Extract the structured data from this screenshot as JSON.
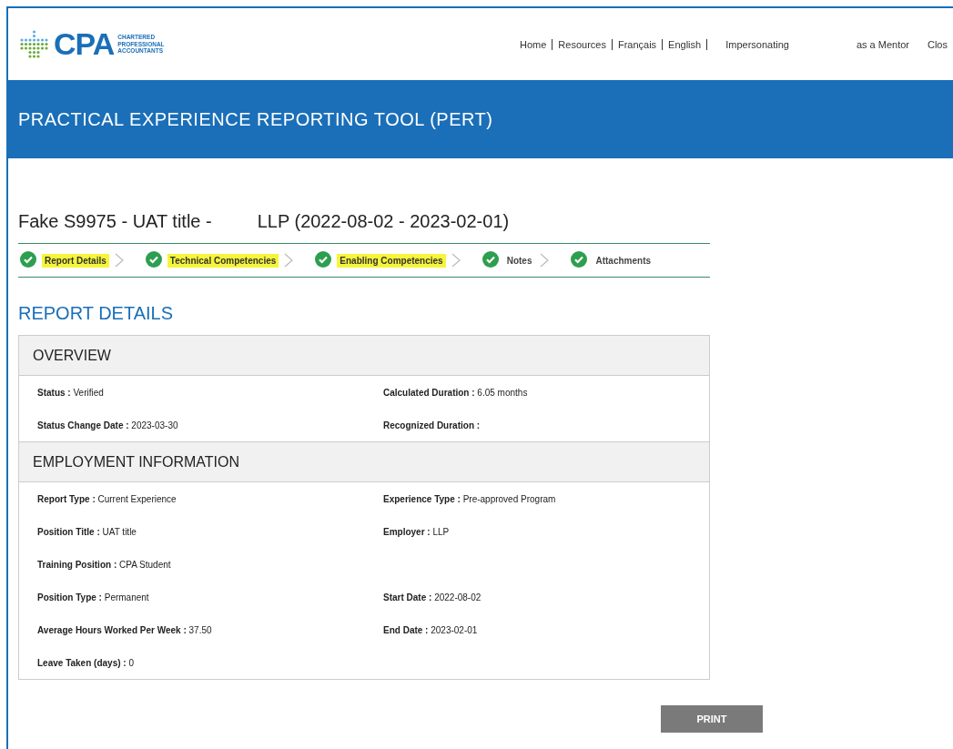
{
  "logo": {
    "mark": "CPA",
    "lines": [
      "CHARTERED",
      "PROFESSIONAL",
      "ACCOUNTANTS"
    ]
  },
  "nav_links": [
    "Home",
    "Resources",
    "Français",
    "English"
  ],
  "impersonation": {
    "label": "Impersonating",
    "role": "as a Mentor"
  },
  "close_link": "Clos",
  "banner_title": "PRACTICAL EXPERIENCE REPORTING TOOL (PERT)",
  "report_title": "Fake S9975 - UAT title -         LLP (2022-08-02 - 2023-02-01)",
  "steps": [
    {
      "label": "Report Details",
      "complete": true,
      "highlighted": true
    },
    {
      "label": "Technical Competencies",
      "complete": true,
      "highlighted": true
    },
    {
      "label": "Enabling Competencies",
      "complete": true,
      "highlighted": true
    },
    {
      "label": "Notes",
      "complete": true,
      "highlighted": false
    },
    {
      "label": "Attachments",
      "complete": true,
      "highlighted": false
    }
  ],
  "section_heading": "REPORT DETAILS",
  "panels": [
    {
      "title": "OVERVIEW",
      "rows": [
        [
          {
            "label": "Status :",
            "value": "Verified"
          },
          {
            "label": "Calculated Duration :",
            "value": "6.05 months"
          }
        ],
        [
          {
            "label": "Status Change Date :",
            "value": "2023-03-30"
          },
          {
            "label": "Recognized Duration :"
          }
        ]
      ]
    },
    {
      "title": "EMPLOYMENT INFORMATION",
      "rows": [
        [
          {
            "label": "Report Type :",
            "value": "Current Experience"
          },
          {
            "label": "Experience Type :",
            "value": "Pre-approved Program"
          }
        ],
        [
          {
            "label": "Position Title :",
            "value": "UAT title"
          },
          {
            "label": "Employer :",
            "value": "LLP"
          }
        ],
        [
          {
            "label": "Training Position :",
            "value": "CPA Student"
          }
        ],
        [
          {
            "label": "Position Type :",
            "value": "Permanent"
          },
          {
            "label": "Start Date :",
            "value": "2022-08-02"
          }
        ],
        [
          {
            "label": "Average Hours Worked Per Week :",
            "value": "37.50"
          },
          {
            "label": "End Date :",
            "value": "2023-02-01"
          }
        ],
        [
          {
            "label": "Leave Taken (days) :",
            "value": "0"
          }
        ]
      ]
    }
  ],
  "print_button": "PRINT"
}
